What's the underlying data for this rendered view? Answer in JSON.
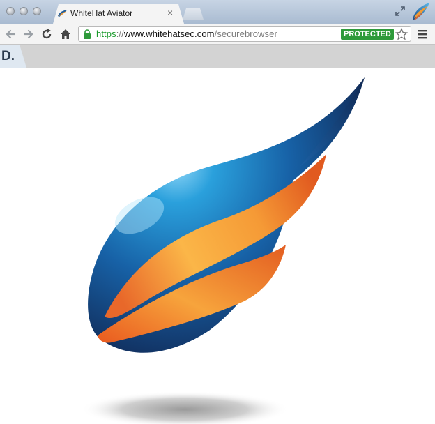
{
  "window": {
    "traffic_lights": [
      "close",
      "minimize",
      "zoom"
    ]
  },
  "tab": {
    "title": "WhiteHat Aviator",
    "favicon": "aviator-wing-icon",
    "close_icon": "close-icon"
  },
  "toolbar": {
    "back_icon": "back-arrow-icon",
    "forward_icon": "forward-arrow-icon",
    "reload_icon": "reload-icon",
    "home_icon": "home-icon",
    "menu_icon": "hamburger-menu-icon"
  },
  "address_bar": {
    "scheme": "https",
    "separator": "://",
    "host": "www.whitehatsec.com",
    "path": "/securebrowser",
    "badge": "PROTECTED",
    "secure_icon": "lock-icon",
    "bookmark_icon": "star-icon"
  },
  "bookmarks_bar": {
    "items": [
      {
        "label": "D."
      }
    ]
  },
  "colors": {
    "secure_green": "#2e9a3a",
    "wing_blue_light": "#79c9f0",
    "wing_blue_dark": "#14315e",
    "wing_orange": "#f6a53a",
    "wing_orange_dark": "#e2611f"
  }
}
